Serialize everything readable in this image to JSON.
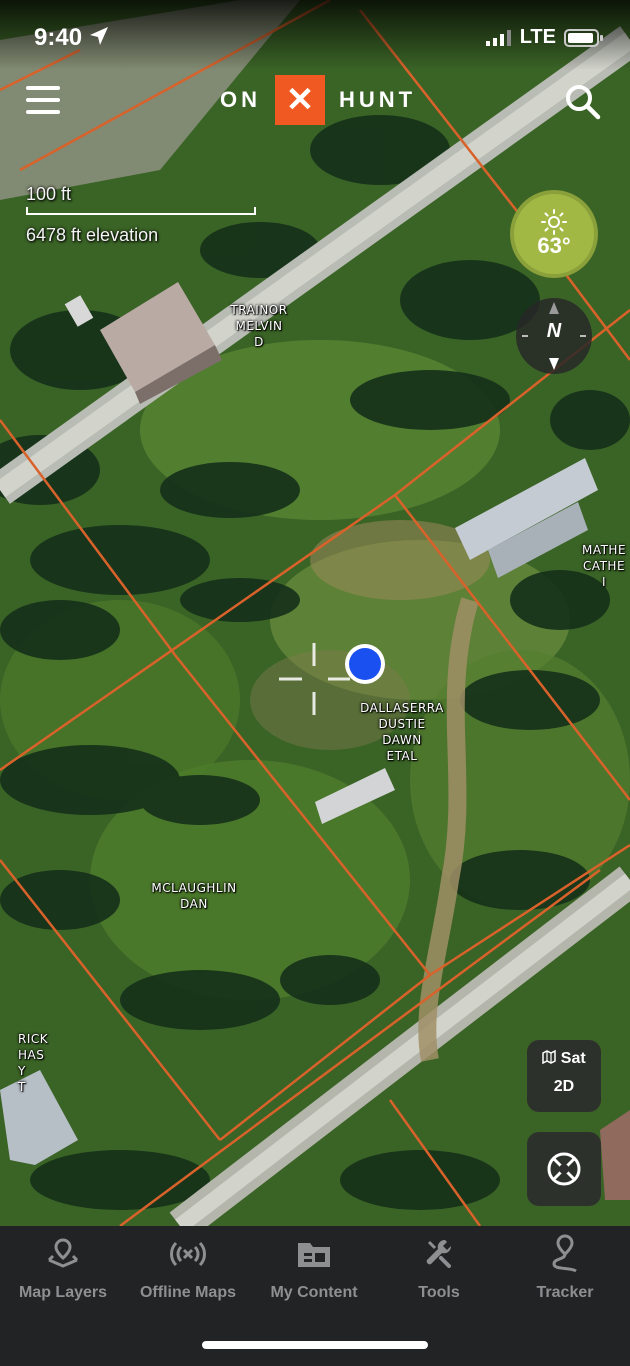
{
  "status_bar": {
    "time": "9:40",
    "network": "LTE",
    "icons": [
      "location-arrow-icon",
      "signal-icon",
      "battery-icon"
    ]
  },
  "header": {
    "logo_left": "ON",
    "logo_mark": "✕",
    "logo_right": "HUNT",
    "menu_icon": "hamburger-icon",
    "search_icon": "search-icon"
  },
  "map": {
    "scale_label": "100 ft",
    "elevation_label": "6478 ft elevation",
    "parcel_labels": [
      "TRAINOR\nMELVIN\nD",
      "MATHE\nCATHE\nI",
      "DALLASERRA\nDUSTIE\nDAWN\nETAL",
      "MCLAUGHLIN\nDAN",
      "RICK\nHAS\nY\nT"
    ],
    "colors": {
      "parcel_line": "#d9622b",
      "location_dot": "#1a4ff0",
      "brand": "#f05a22"
    }
  },
  "weather": {
    "icon": "sun-icon",
    "temperature": "63°"
  },
  "compass": {
    "label": "N"
  },
  "layer_toggle": {
    "icon": "map-icon",
    "layer": "Sat",
    "mode": "2D"
  },
  "locate": {
    "icon": "locate-target-icon"
  },
  "tab_bar": {
    "tabs": [
      {
        "label": "Map Layers",
        "icon": "map-layers-icon"
      },
      {
        "label": "Offline Maps",
        "icon": "offline-broadcast-icon"
      },
      {
        "label": "My Content",
        "icon": "folder-icon"
      },
      {
        "label": "Tools",
        "icon": "tools-icon"
      },
      {
        "label": "Tracker",
        "icon": "tracker-pin-icon"
      }
    ]
  }
}
